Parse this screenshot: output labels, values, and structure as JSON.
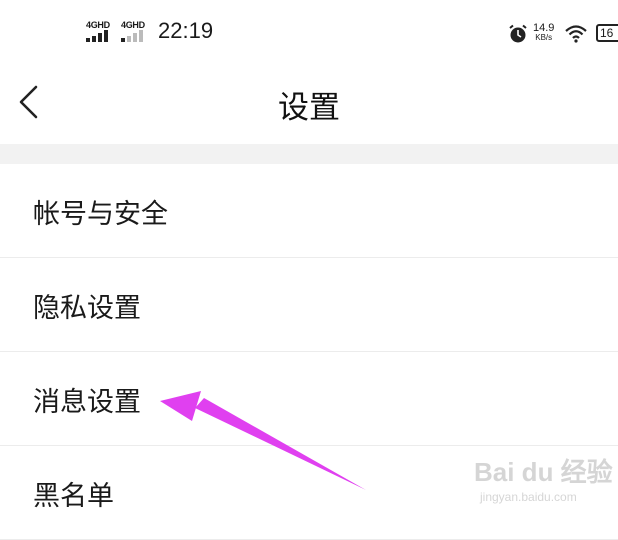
{
  "status_bar": {
    "signal_1_label": "4GHD",
    "signal_2_label": "4GHD",
    "time": "22:19",
    "network_speed_value": "14.9",
    "network_speed_unit": "KB/s",
    "battery_level": "16",
    "icons": [
      "signal-icon",
      "alarm-icon",
      "wifi-icon",
      "battery-icon"
    ]
  },
  "nav": {
    "back_icon": "chevron-left-icon",
    "title": "设置"
  },
  "menu": {
    "items": [
      {
        "label": "帐号与安全"
      },
      {
        "label": "隐私设置"
      },
      {
        "label": "消息设置"
      },
      {
        "label": "黑名单"
      }
    ]
  },
  "annotation": {
    "arrow_color": "#e040f0",
    "points_to": "消息设置"
  },
  "watermark": {
    "brand": "Bai du 经验",
    "site": "jingyan.baidu.com"
  },
  "colors": {
    "background": "#ffffff",
    "divider": "#f2f2f2",
    "text": "#1a1a1a"
  }
}
